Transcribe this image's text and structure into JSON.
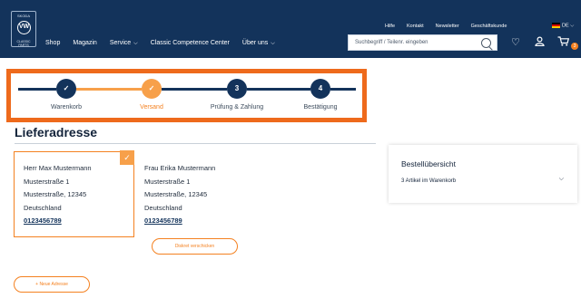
{
  "brand": {
    "logo_top": "SKODA",
    "logo_mark": "VW",
    "logo_bottom": "CLASSIC PARTS"
  },
  "main_nav": [
    {
      "label": "Shop"
    },
    {
      "label": "Magazin"
    },
    {
      "label": "Service",
      "chevron": true
    },
    {
      "label": "Classic Competence Center"
    },
    {
      "label": "Über uns",
      "chevron": true
    }
  ],
  "util_nav": [
    "Hilfe",
    "Kontakt",
    "Newsletter",
    "Geschäftskunde"
  ],
  "language": "DE",
  "search": {
    "placeholder": "Suchbegriff / Teilenr. eingeben"
  },
  "icons": {
    "search": "search-icon",
    "wishlist": "heart-icon",
    "account": "user-icon",
    "cart": "cart-icon"
  },
  "cart_count": "3",
  "steps": [
    {
      "number": "✓",
      "label": "Warenkorb",
      "state": "done"
    },
    {
      "number": "✓",
      "label": "Versand",
      "state": "active"
    },
    {
      "number": "3",
      "label": "Prüfung & Zahlung",
      "state": "todo"
    },
    {
      "number": "4",
      "label": "Bestätigung",
      "state": "todo"
    }
  ],
  "section_title": "Lieferadresse",
  "addresses": [
    {
      "name": "Herr Max Mustermann",
      "line1": "Musterstraße 1",
      "line2": "Musterstraße, 12345",
      "country": "Deutschland",
      "phone": "0123456789",
      "selected": true
    },
    {
      "name": "Frau Erika Mustermann",
      "line1": "Musterstraße 1",
      "line2": "Musterstraße, 12345",
      "country": "Deutschland",
      "phone": "0123456789",
      "selected": false
    }
  ],
  "buttons": {
    "discrete_ship": "Diskret verschicken",
    "new_address": "+ Neue Adresse"
  },
  "summary": {
    "title": "Bestellübersicht",
    "items": "3 Artikel im Warenkorb"
  },
  "colors": {
    "navy": "#13335b",
    "orange": "#f48120",
    "highlight_border": "#ee6a1c"
  }
}
